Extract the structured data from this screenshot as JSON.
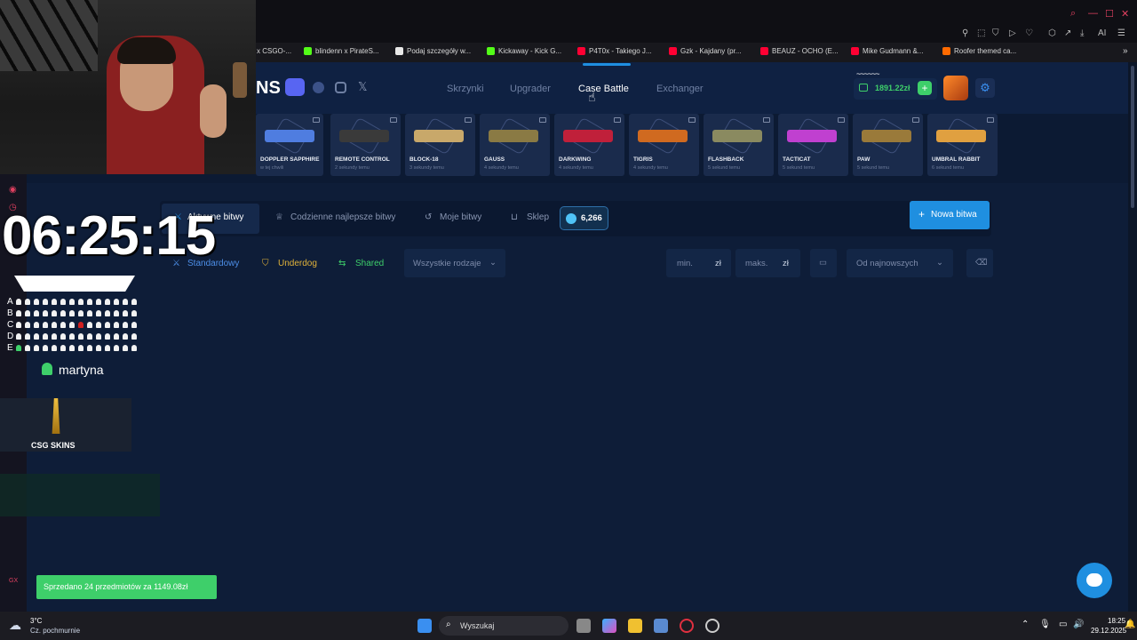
{
  "browser": {
    "bookmarks": [
      {
        "label": "x CSGO-...",
        "color": "#1b2838"
      },
      {
        "label": "blindenn x PirateS...",
        "color": "#53fc18"
      },
      {
        "label": "Podaj szczegóły w...",
        "color": "#e8e8e8"
      },
      {
        "label": "Kickaway - Kick G...",
        "color": "#53fc18"
      },
      {
        "label": "P4T0x - Takiego J...",
        "color": "#ff0033"
      },
      {
        "label": "Gzk - Kajdany (pr...",
        "color": "#ff0033"
      },
      {
        "label": "BEAUZ - OCHO (E...",
        "color": "#ff0033"
      },
      {
        "label": "Mike Gudmann &...",
        "color": "#ff0033"
      },
      {
        "label": "Roofer themed ca...",
        "color": "#ff6a00"
      }
    ],
    "ai_label": "AI"
  },
  "site": {
    "logo_text": "NS",
    "nav": [
      "Skrzynki",
      "Upgrader",
      "Case Battle",
      "Exchanger"
    ],
    "nav_active": "Case Battle",
    "balance": "1891.22zł",
    "username": "~~~~~~",
    "drops": [
      {
        "name": "DOPPLER SAPPHIRE",
        "time": "w tej chwili",
        "color": "#4f7de0"
      },
      {
        "name": "REMOTE CONTROL",
        "time": "2 sekundy temu",
        "color": "#3a3a3a"
      },
      {
        "name": "BLOCK-18",
        "time": "3 sekundy temu",
        "color": "#c8a86a"
      },
      {
        "name": "GAUSS",
        "time": "4 sekundy temu",
        "color": "#8a7a44"
      },
      {
        "name": "DARKWING",
        "time": "4 sekundy temu",
        "color": "#c0203a"
      },
      {
        "name": "TIGRIS",
        "time": "4 sekundy temu",
        "color": "#d06a20"
      },
      {
        "name": "FLASHBACK",
        "time": "5 sekund temu",
        "color": "#8a8a60"
      },
      {
        "name": "TACTICAT",
        "time": "5 sekund temu",
        "color": "#c040d0"
      },
      {
        "name": "PAW",
        "time": "5 sekund temu",
        "color": "#9a7a3a"
      },
      {
        "name": "UMBRAL RABBIT",
        "time": "6 sekund temu",
        "color": "#e0a040"
      }
    ],
    "tabs": {
      "active": "Aktywne bitwy",
      "daily": "Codzienne najlepsze bitwy",
      "mine": "Moje bitwy",
      "shop": "Sklep",
      "coins": "6,266",
      "new_battle": "Nowa bitwa"
    },
    "filters": {
      "standard": "Standardowy",
      "underdog": "Underdog",
      "shared": "Shared",
      "all_types": "Wszystkie rodzaje",
      "min_placeholder": "min.",
      "max_placeholder": "maks.",
      "currency": "zł",
      "sort": "Od najnowszych"
    },
    "toast": "Sprzedano 24 przedmiotów za 1149.08zł",
    "url_hint": "https://csgo-skins.com/case-battle"
  },
  "overlay": {
    "clock": "06:25:15",
    "seat_rows": [
      "A",
      "B",
      "C",
      "D",
      "E"
    ],
    "viewer_name": "martyna",
    "sponsor_label": "CSG SKINS"
  },
  "taskbar": {
    "weather_temp": "3°C",
    "weather_desc": "Cz. pochmurnie",
    "search": "Wyszukaj",
    "time": "18:25",
    "date": "29.12.2025"
  },
  "colors": {
    "accent": "#1f8fe0",
    "green": "#3ecf6a",
    "bg": "#0e1d38"
  }
}
